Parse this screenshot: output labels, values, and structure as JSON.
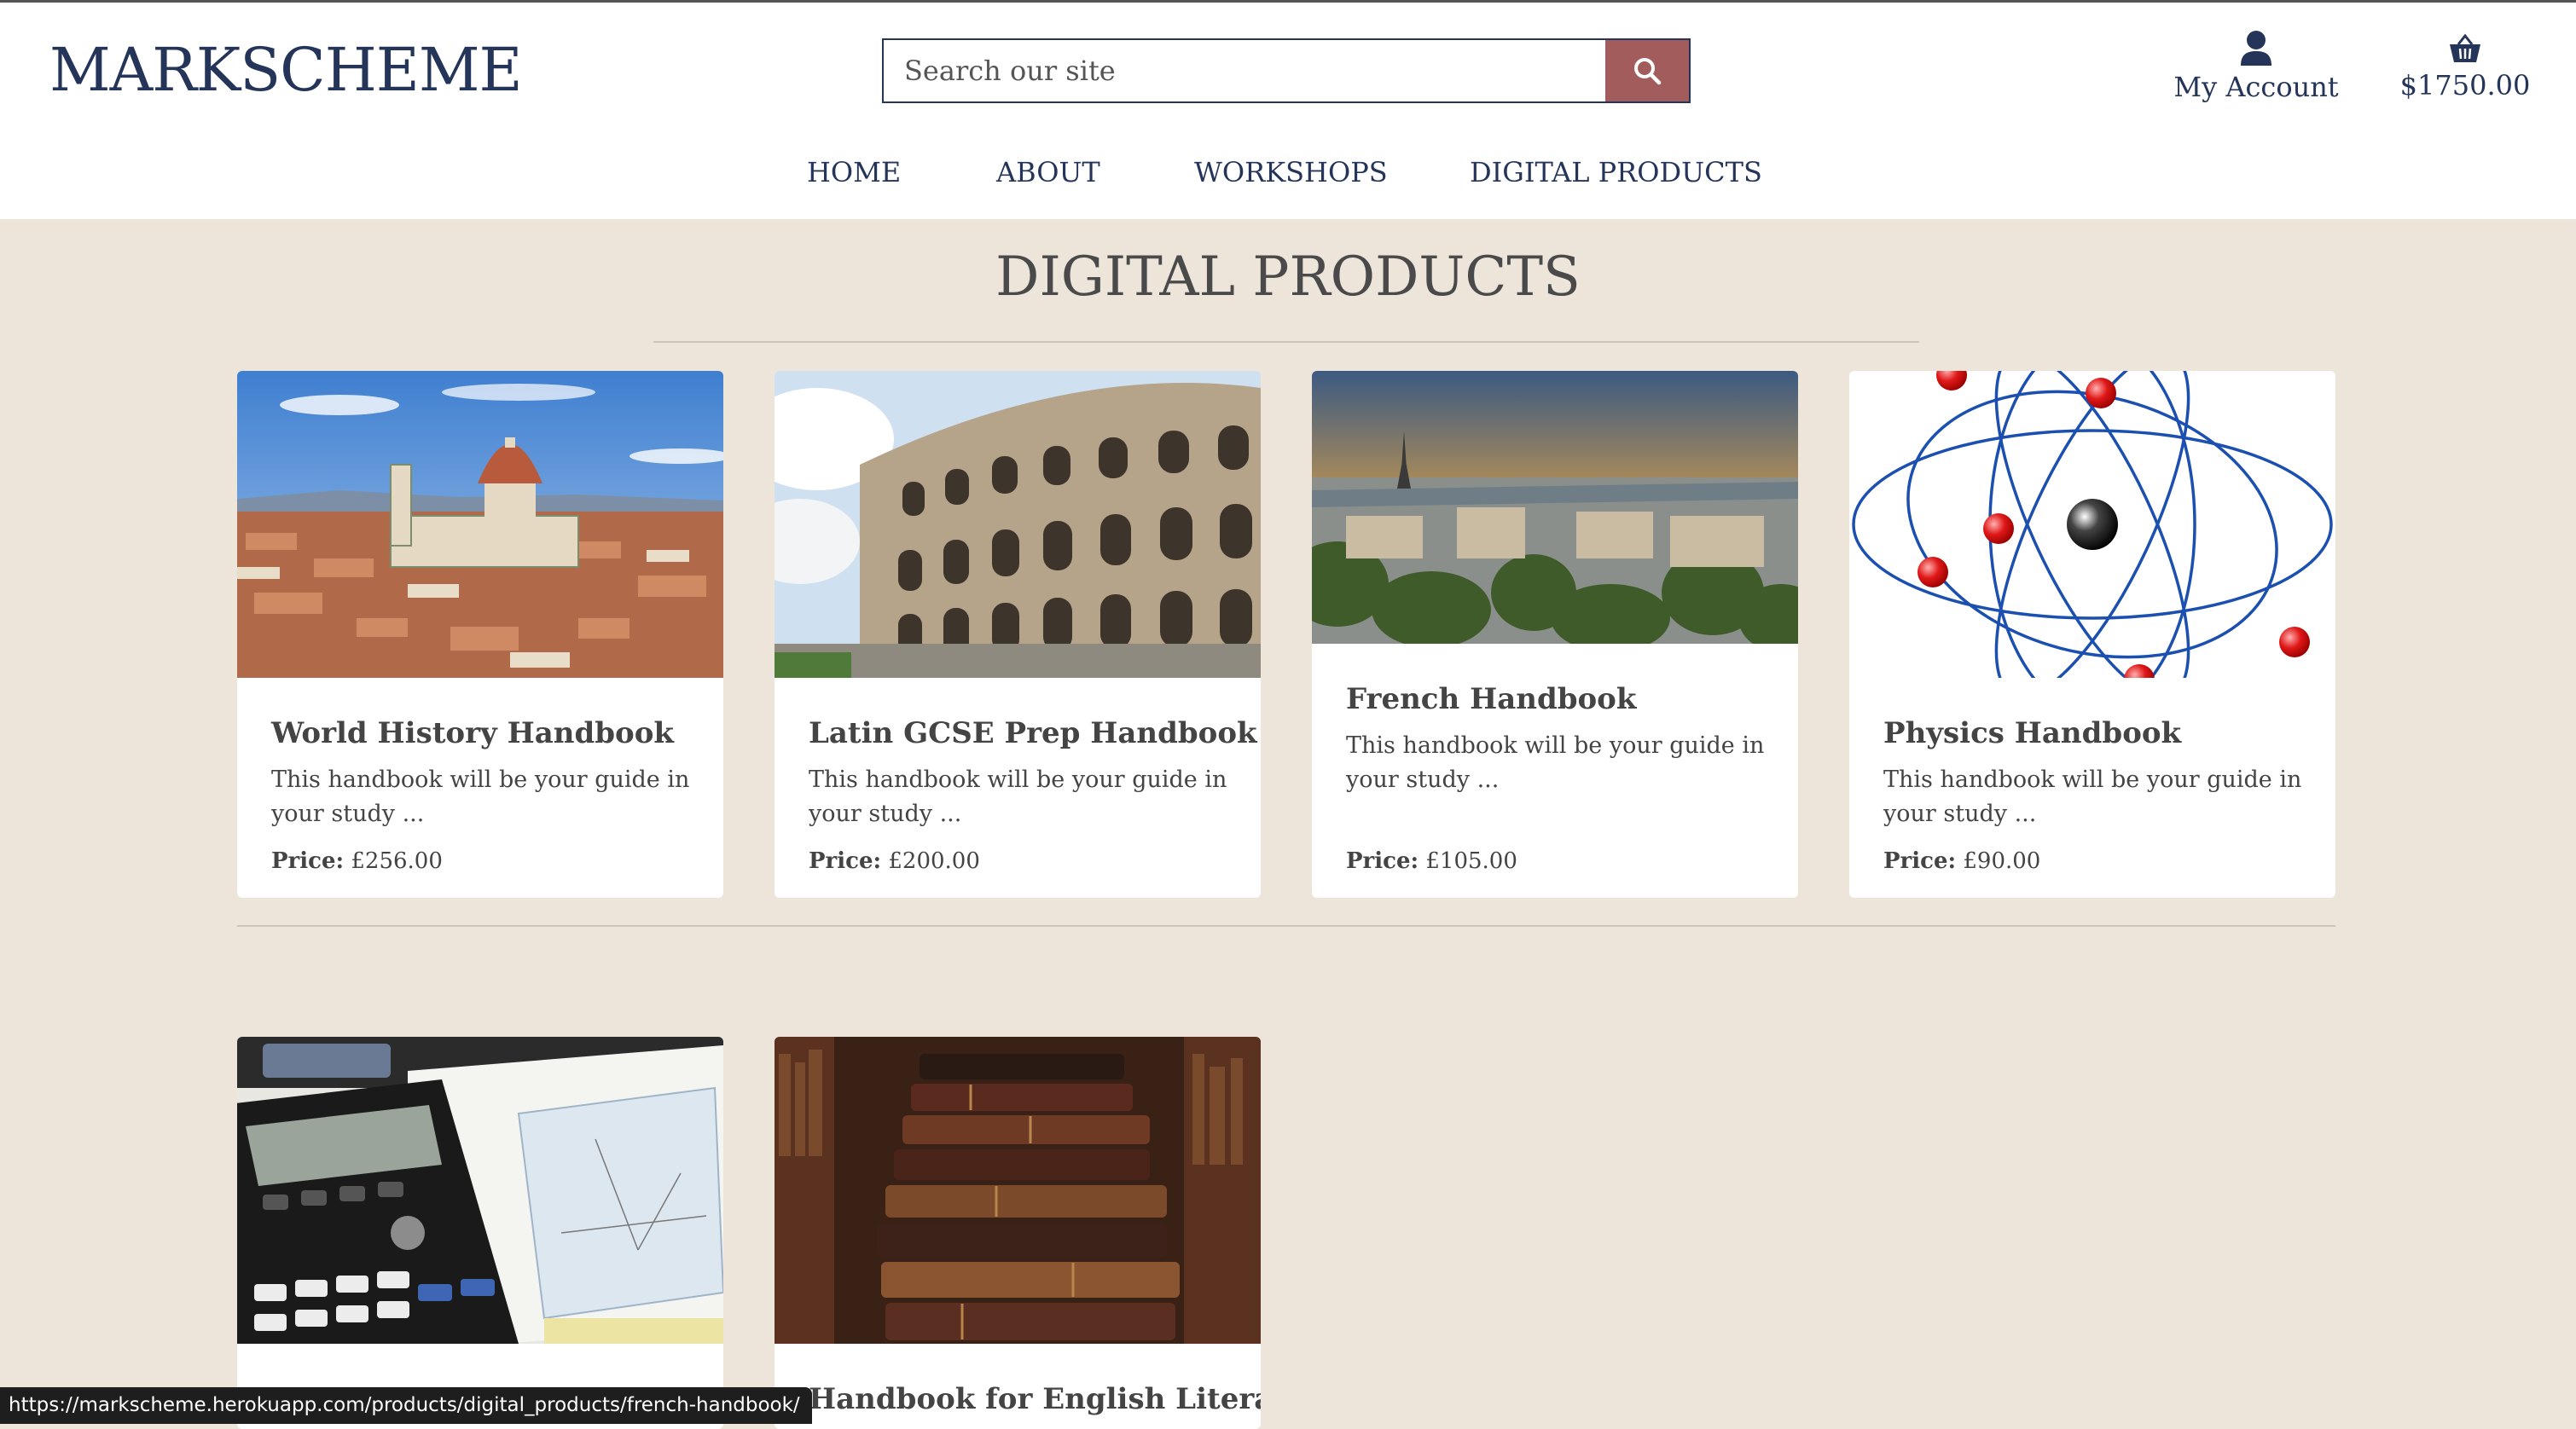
{
  "header": {
    "logo": "MARKSCHEME",
    "search_placeholder": "Search our site",
    "account_label": "My Account",
    "basket_total": "$1750.00"
  },
  "nav": {
    "items": [
      "HOME",
      "ABOUT",
      "WORKSHOPS",
      "DIGITAL PRODUCTS"
    ]
  },
  "page": {
    "title": "DIGITAL PRODUCTS"
  },
  "products": [
    {
      "title": "World History Handbook",
      "desc_line1": "This handbook will be your guide in",
      "desc_line2": "your study ...",
      "price_label": "Price:",
      "price": "£256.00",
      "image": "florence-cathedral-photo"
    },
    {
      "title": "Latin GCSE Prep Handbook",
      "desc_line1": "This handbook will be your guide in",
      "desc_line2": "your study ...",
      "price_label": "Price:",
      "price": "£200.00",
      "image": "colosseum-photo"
    },
    {
      "title": "French Handbook",
      "desc_line1": "This handbook will be your guide in",
      "desc_line2": "your study ...",
      "price_label": "Price:",
      "price": "£105.00",
      "image": "paris-skyline-photo"
    },
    {
      "title": "Physics Handbook",
      "desc_line1": "This handbook will be your guide in",
      "desc_line2": "your study ...",
      "price_label": "Price:",
      "price": "£90.00",
      "image": "atom-illustration"
    },
    {
      "title": "",
      "image": "calculator-notes-photo"
    },
    {
      "title": "Handbook for English Literature",
      "image": "antique-books-photo"
    }
  ],
  "status_bar": {
    "url": "https://markscheme.herokuapp.com/products/digital_products/french-handbook/"
  },
  "colors": {
    "brand_navy": "#25355a",
    "search_button": "#a35c5c",
    "page_background": "#ede4da"
  }
}
